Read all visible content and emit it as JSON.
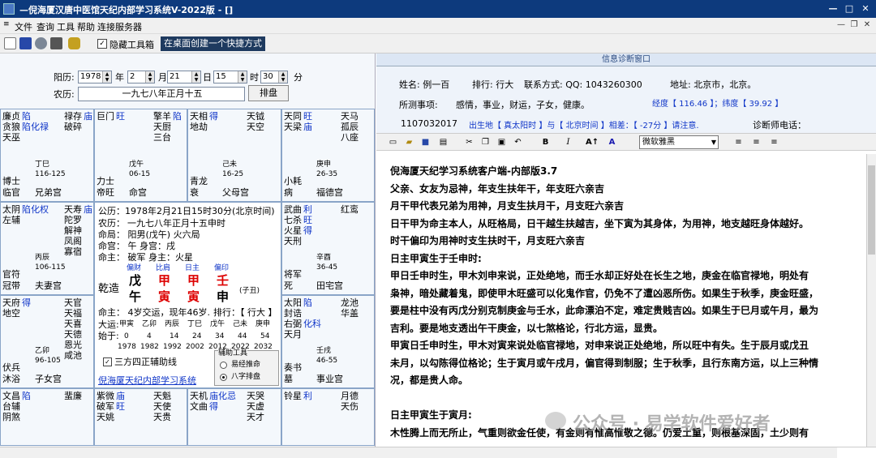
{
  "window": {
    "title": "—倪海厦汉唐中医馆天纪内部学习系统V-2022版 - []",
    "min_glyph": "—",
    "max_glyph": "□",
    "close_glyph": "✕"
  },
  "menu": {
    "items": [
      "文件",
      "查询",
      "工具",
      "帮助",
      "连接服务器"
    ],
    "mdi_min": "—",
    "mdi_restore": "❐",
    "mdi_close": "✕"
  },
  "toolbar": {
    "icons": [
      "new-file-icon",
      "save-icon",
      "search-icon",
      "print-icon",
      "tools-icon"
    ],
    "hide_toolbar_label": "隐藏工具箱",
    "hide_toolbar_checked": true,
    "shortcut_label": "在桌面创建一个快捷方式"
  },
  "form": {
    "solar_label": "阳历:",
    "year": "1978",
    "year_unit": "年",
    "month": "2",
    "month_unit": "月",
    "day": "21",
    "day_unit": "日",
    "hour": "15",
    "hour_unit": "时",
    "minute": "30",
    "minute_unit": "分",
    "lunar_label": "农历:",
    "lunar_value": "一九七八年正月十五",
    "arrange_button": "排盘"
  },
  "chart": {
    "palaces": [
      {
        "main": [
          "廉贞",
          "贪狼",
          "天巫"
        ],
        "hua": [
          "陷",
          "陷化禄"
        ],
        "minor": [
          "禄存",
          "破碎"
        ],
        "minor_tag": "庙",
        "top": "丁巳",
        "range": "116-125",
        "god": "博士",
        "palace": "临官",
        "name": "兄弟宫"
      },
      {
        "main": [
          "巨门",
          ""
        ],
        "hua": [
          "旺",
          ""
        ],
        "minor": [
          "擎羊",
          "天厨",
          "三台"
        ],
        "minor_tag": "陷",
        "top": "戊午",
        "range": "06-15",
        "god": "力士",
        "palace": "帝旺",
        "name": "命宫"
      },
      {
        "main": [
          "天相",
          "地劫"
        ],
        "hua": [
          "得",
          ""
        ],
        "minor": [
          "天钺",
          "天空"
        ],
        "minor_tag": "",
        "top": "己未",
        "range": "16-25",
        "god": "青龙",
        "palace": "衰",
        "name": "父母宫"
      },
      {
        "main": [
          "天同",
          "天梁"
        ],
        "hua": [
          "旺",
          "庙"
        ],
        "minor": [
          "天马",
          "孤辰",
          "八座"
        ],
        "minor_tag": "",
        "top": "庚申",
        "range": "26-35",
        "god": "小耗",
        "palace": "病",
        "name": "福德宫"
      },
      {
        "main": [
          "太阴",
          "左辅"
        ],
        "hua": [
          "陷化权",
          ""
        ],
        "minor": [
          "天寿",
          "陀罗",
          "解神",
          "凤阁",
          "寡宿"
        ],
        "minor_tag": "庙",
        "top": "丙辰",
        "range": "106-115",
        "god": "官符",
        "palace": "冠带",
        "name": "夫妻宫"
      },
      {
        "main": [
          "武曲",
          "七杀",
          "火星",
          "天刑"
        ],
        "hua": [
          "利",
          "旺",
          "得",
          ""
        ],
        "minor": [
          "红鸾"
        ],
        "minor_tag": "",
        "top": "辛酉",
        "range": "36-45",
        "god": "将军",
        "palace": "死",
        "name": "田宅宫"
      },
      {
        "main": [
          "天府",
          "地空"
        ],
        "hua": [
          "得",
          ""
        ],
        "minor": [
          "天官",
          "天福",
          "天喜",
          "天德",
          "恩光",
          "咸池"
        ],
        "minor_tag": "",
        "top": "乙卯",
        "range": "96-105",
        "god": "伏兵",
        "palace": "沐浴",
        "name": "子女宫"
      },
      {
        "main": [
          "太阳",
          "封诰",
          "右弼",
          "天月"
        ],
        "hua": [
          "陷",
          "",
          "化科",
          ""
        ],
        "minor": [
          "龙池",
          "华盖"
        ],
        "minor_tag": "",
        "top": "壬戌",
        "range": "46-55",
        "god": "奏书",
        "palace": "墓",
        "name": "事业宫"
      },
      {
        "main": [
          "文昌",
          "台辅",
          "阴煞"
        ],
        "hua": [
          "陷",
          "",
          ""
        ],
        "minor": [
          "蜚廉"
        ],
        "minor_tag": "",
        "top": "",
        "range": "",
        "god": "",
        "palace": "",
        "name": ""
      },
      {
        "main": [
          "紫微",
          "破军",
          "天姚"
        ],
        "hua": [
          "庙",
          "旺",
          ""
        ],
        "minor": [
          "天魁",
          "天使",
          "天贵"
        ],
        "minor_tag": "",
        "top": "",
        "range": "",
        "god": "",
        "palace": "",
        "name": ""
      },
      {
        "main": [
          "天机",
          "文曲"
        ],
        "hua": [
          "庙化忌",
          "得"
        ],
        "minor": [
          "天哭",
          "天虚",
          "天才"
        ],
        "minor_tag": "",
        "top": "",
        "range": "",
        "god": "",
        "palace": "",
        "name": ""
      },
      {
        "main": [
          "铃星"
        ],
        "hua": [
          "利"
        ],
        "minor": [
          "月德",
          "天伤"
        ],
        "minor_tag": "",
        "top": "",
        "range": "",
        "god": "",
        "palace": "",
        "name": ""
      }
    ],
    "center": {
      "l1": "公历：1978年2月21日15时30分(北京时间)",
      "l2": "一九七八年正月十五申时",
      "l3a": "农历：",
      "l3b": "一九七八年正月十五申时",
      "l4": "命局： 阳男(戊午)     火六局",
      "l5": "命宫： 午     身宫：戌",
      "l6": "命主： 破军 身主：火星",
      "gods": [
        "偏财",
        "比肩",
        "日主",
        "偏印"
      ],
      "label": "乾造",
      "stems": [
        "戊",
        "甲",
        "甲",
        "壬"
      ],
      "branches": [
        "午",
        "寅",
        "寅",
        "申"
      ],
      "zi_han": "(子丑)",
      "l9": "命主：  4岁交运，现年46岁.",
      "rank_label": "排行：【 行大 】",
      "dayun_label": "大运:",
      "dayun": [
        "甲寅",
        "乙卯",
        "丙辰",
        "丁巳",
        "戊午",
        "己未",
        "庚申"
      ],
      "start_label": "始于:",
      "ages": [
        "0",
        "4",
        "14",
        "24",
        "34",
        "44",
        "54"
      ],
      "years": [
        "1978",
        "1982",
        "1992",
        "2002",
        "2012",
        "2022",
        "2032"
      ],
      "aux_check": "三方四正辅助线",
      "aux_checked": true,
      "aux_tools": "辅助工具",
      "radio1": "易经推命",
      "radio2": "八字排盘",
      "link": "倪海厦天纪内部学习系统"
    }
  },
  "right": {
    "panel_title": "信息诊断窗口",
    "name_label": "姓名: 例一百",
    "rank": "排行: 行大",
    "contact": "联系方式: QQ: 1043260300",
    "address": "地址:   北京市，北京。",
    "matters_label": "所测事项:",
    "matters": "感情，事业，财运，子女，健康。",
    "longitude": "经度【 116.46 】；纬度【 39.92 】",
    "number": "1107032017",
    "birth_note": "出生地【 真太阳时 】与【 北京时间 】相差：【 -27分 】请注意.",
    "doctor_label": "诊断师电话：",
    "font_name": "微软雅黑",
    "doc_lines": [
      "倪海厦天纪学习系统客户端-内部版3.7",
      "父亲、女友为忌神，年支生扶年干，年支旺六亲吉",
      "月干甲代表兄弟为用神，月支生扶月干，月支旺六亲吉",
      "日干甲为命主本人，从旺格局，日干越生扶越吉，坐下寅为其身体，为用神，地支越旺身体越好。",
      "时干偏印为用神时支生扶时干，月支旺六亲吉",
      "日主甲寅生于壬申时:",
      "   甲日壬申时生，甲木刘申来说，正处绝地，而壬水却正好处在长生之地，庚金在临官禄地，明处有",
      "枭神，暗处藏着鬼，即使甲木旺盛可以化鬼作官，仍免不了遭凶恶所伤。如果生于秋季，庚金旺盛，",
      "要是柱中没有丙戊分别克制庚金与壬水，此命漂泊不定，难定贵贱吉凶。如果生于巳月或午月，最为",
      "吉利。要是地支透出午干庚金，以七煞格论，行北方运，显贵。",
      "   甲寅日壬申时生，甲木对寅来说处临官禄地，对申来说正处绝地，所以旺中有失。生于辰月或戊丑",
      "未月，以勾陈得位格论；生于寅月或午戌月，偏官得到制服；生于秋季，且行东南方运，以上三种情",
      "况，都是贵人命。",
      "",
      "日主甲寅生于寅月:",
      "   木性腾上而无所止，气重则欲金任使，有金则有惟高惟敬之德。仍爱土重，则根基深固，土少则有"
    ]
  },
  "watermark": {
    "text": "公众号 · 易学软件爱好者"
  }
}
